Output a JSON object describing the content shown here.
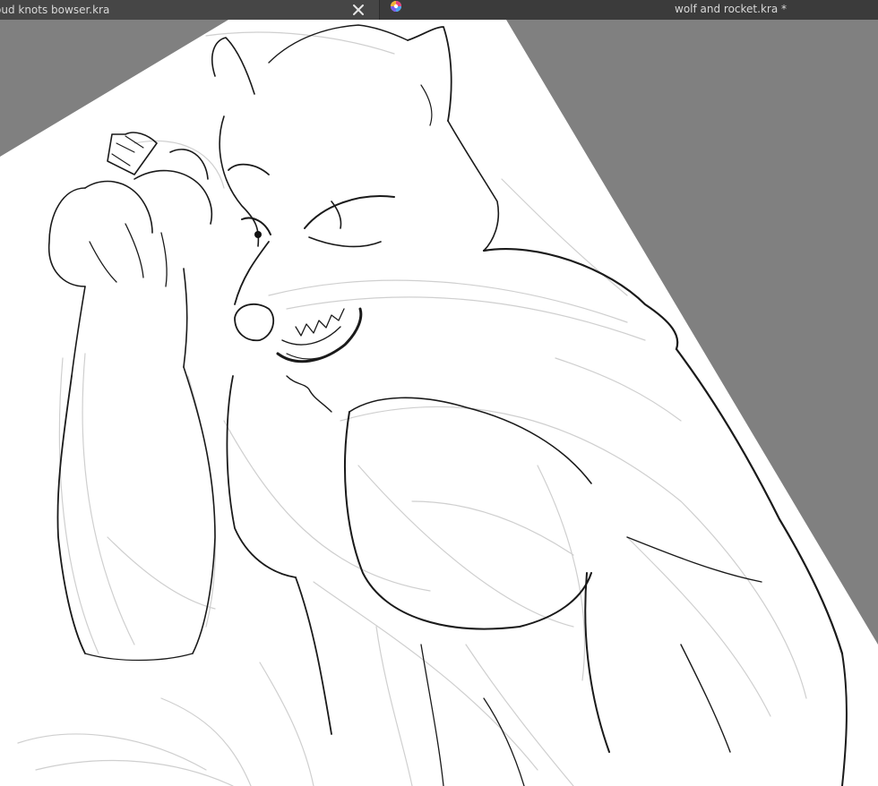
{
  "tabs": [
    {
      "title": "oud knots bowser.kra",
      "active": false,
      "closable": true
    },
    {
      "title": "wolf and rocket.kra *",
      "active": true
    }
  ],
  "icons": {
    "close": "close-icon",
    "app": "krita-app-icon"
  },
  "colors": {
    "tabbar": "#3b3b3b",
    "workspace": "#808080",
    "canvas": "#ffffff",
    "lineart": "#111111",
    "sketch": "#cfcfcf"
  }
}
